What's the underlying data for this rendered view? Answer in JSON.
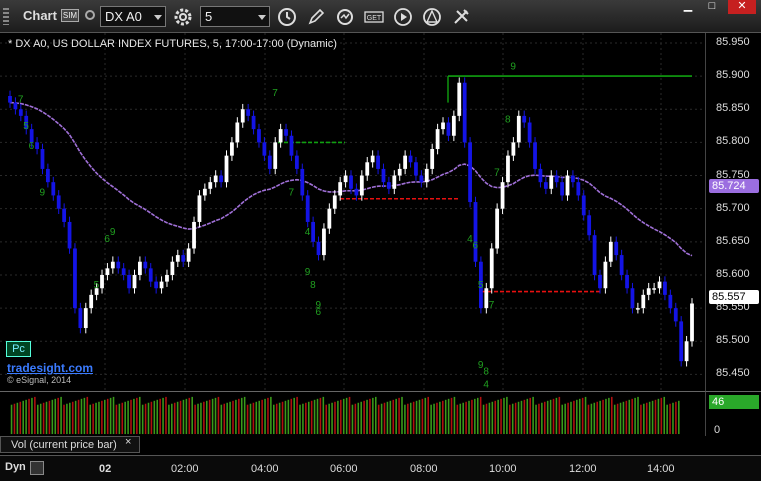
{
  "toolbar": {
    "chart_label": "Chart",
    "sim_icon": "SIM",
    "symbol": "DX A0",
    "interval": "5",
    "win_minimize": "▁",
    "win_maximize": "□",
    "win_close": "✕"
  },
  "chart": {
    "title": "* DX A0, US DOLLAR INDEX FUTURES, 5, 17:00-17:00 (Dynamic)",
    "last_price": "85.557",
    "ma_price": "85.724",
    "pc_button": "Pc",
    "watermark": "tradesight.com",
    "copyright": "© eSignal, 2014"
  },
  "volume": {
    "label": "Vol (current price bar)",
    "close": "×",
    "last": "46",
    "zero": "0"
  },
  "time_axis": {
    "dyn": "Dyn",
    "ticks": [
      "02",
      "02:00",
      "04:00",
      "06:00",
      "08:00",
      "10:00",
      "12:00",
      "14:00"
    ]
  },
  "colors": {
    "bull": "#ffffff",
    "bear": "#1414e6",
    "ma": "#a070d8",
    "resistance": "#10a010",
    "support": "#e81010",
    "count": "#20a020",
    "vol_up": "#3a9a1a",
    "vol_down": "#b01010"
  },
  "chart_data": {
    "type": "candlestick",
    "y_axis": {
      "min": 85.425,
      "max": 85.965,
      "ticks": [
        "85.950",
        "85.900",
        "85.850",
        "85.800",
        "85.750",
        "85.700",
        "85.650",
        "85.600",
        "85.550",
        "85.500",
        "85.450"
      ]
    },
    "x_ticks": [
      "02",
      "02:00",
      "04:00",
      "06:00",
      "08:00",
      "10:00",
      "12:00",
      "14:00"
    ],
    "close": [
      85.86,
      85.85,
      85.84,
      85.82,
      85.8,
      85.79,
      85.76,
      85.74,
      85.72,
      85.7,
      85.68,
      85.64,
      85.55,
      85.52,
      85.55,
      85.57,
      85.58,
      85.6,
      85.61,
      85.62,
      85.61,
      85.6,
      85.58,
      85.6,
      85.62,
      85.61,
      85.59,
      85.58,
      85.59,
      85.6,
      85.62,
      85.63,
      85.62,
      85.64,
      85.68,
      85.72,
      85.73,
      85.74,
      85.75,
      85.74,
      85.78,
      85.8,
      85.83,
      85.85,
      85.84,
      85.82,
      85.8,
      85.78,
      85.76,
      85.8,
      85.82,
      85.81,
      85.78,
      85.76,
      85.72,
      85.68,
      85.65,
      85.63,
      85.67,
      85.7,
      85.72,
      85.74,
      85.75,
      85.73,
      85.72,
      85.75,
      85.77,
      85.78,
      85.76,
      85.74,
      85.73,
      85.75,
      85.76,
      85.78,
      85.77,
      85.75,
      85.74,
      85.76,
      85.79,
      85.82,
      85.83,
      85.81,
      85.84,
      85.89,
      85.8,
      85.71,
      85.62,
      85.55,
      85.58,
      85.64,
      85.7,
      85.74,
      85.78,
      85.8,
      85.84,
      85.83,
      85.8,
      85.76,
      85.74,
      85.73,
      85.75,
      85.74,
      85.72,
      85.75,
      85.74,
      85.72,
      85.69,
      85.66,
      85.6,
      85.58,
      85.62,
      85.65,
      85.63,
      85.6,
      85.58,
      85.55,
      85.55,
      85.57,
      85.58,
      85.58,
      85.59,
      85.57,
      85.55,
      85.53,
      85.47,
      85.5,
      85.557
    ],
    "series": [
      {
        "name": "",
        "kind": "moving-average",
        "last": 85.724
      }
    ],
    "reference_lines": [
      {
        "price": 85.9,
        "color": "green"
      },
      {
        "price": 85.8,
        "color": "green",
        "style": "dashed"
      },
      {
        "price": 85.715,
        "color": "red",
        "style": "dashed"
      },
      {
        "price": 85.575,
        "color": "red",
        "style": "dashed"
      }
    ],
    "count_labels": [
      "7",
      "5",
      "6",
      "9",
      "6",
      "9",
      "5",
      "7",
      "4",
      "7",
      "9",
      "6",
      "8",
      "9",
      "4",
      "5",
      "6",
      "7",
      "8",
      "9",
      "4",
      "7",
      "8",
      "9"
    ],
    "volume": {
      "zero_label": "0",
      "last": 46
    }
  }
}
